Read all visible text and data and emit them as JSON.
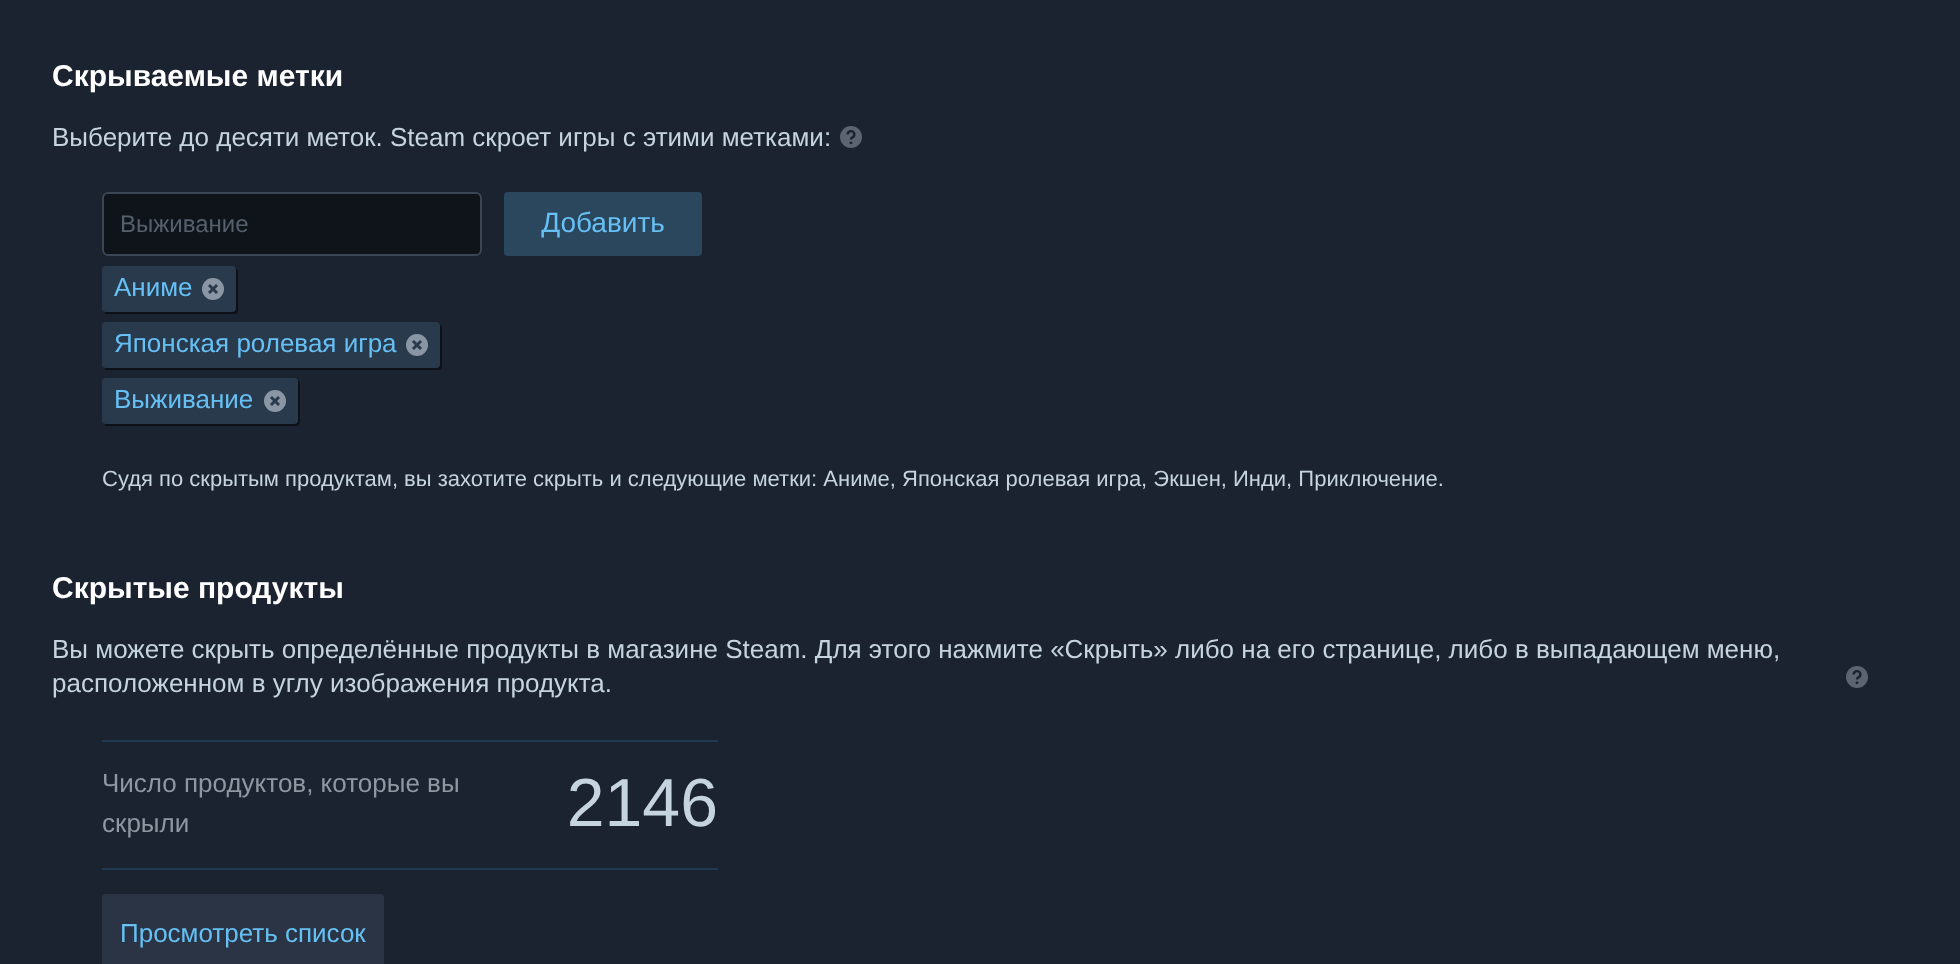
{
  "hidden_tags": {
    "title": "Скрываемые метки",
    "description": "Выберите до десяти меток. Steam скроет игры с этими метками:",
    "input": {
      "placeholder": "Выживание"
    },
    "add_button": "Добавить",
    "tags": [
      {
        "label": "Аниме"
      },
      {
        "label": "Японская ролевая игра"
      },
      {
        "label": "Выживание"
      }
    ],
    "suggestion": "Судя по скрытым продуктам, вы захотите скрыть и следующие метки: Аниме, Японская ролевая игра, Экшен, Инди, Приключение."
  },
  "hidden_products": {
    "title": "Скрытые продукты",
    "description": "Вы можете скрыть определённые продукты в магазине Steam. Для этого нажмите «Скрыть» либо на его странице, либо в выпадающем меню, расположенном в углу изображения продукта.",
    "stat_label": "Число продуктов, которые вы скрыли",
    "stat_value": "2146",
    "view_button": "Просмотреть список"
  }
}
